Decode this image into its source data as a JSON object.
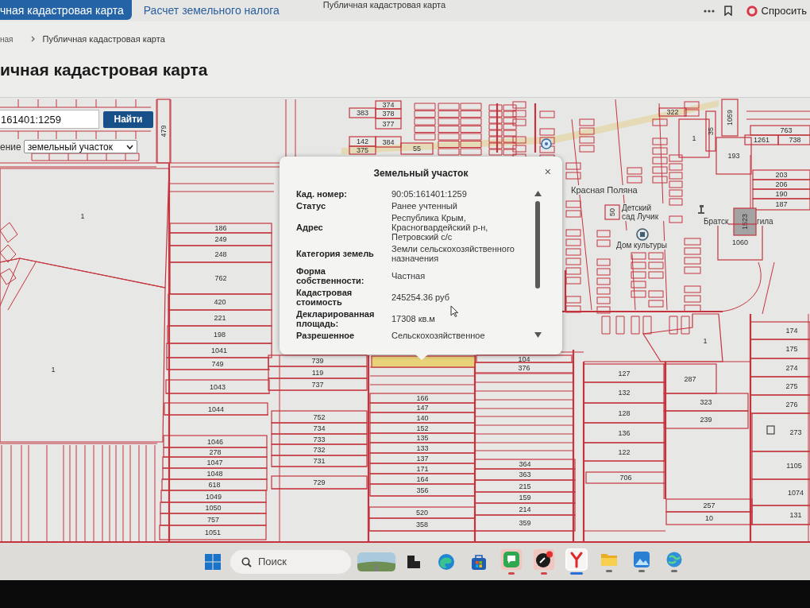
{
  "browser": {
    "page_title": "Публичная кадастровая карта",
    "ask_button": "Спросить"
  },
  "site_tabs": [
    {
      "label": "чная кадастровая карта",
      "selected": true
    },
    {
      "label": "Расчет земельного налога",
      "selected": false
    }
  ],
  "breadcrumbs": [
    {
      "label": "ная"
    },
    {
      "label": "Публичная кадастровая карта"
    }
  ],
  "heading": "ичная кадастровая карта",
  "map_search": {
    "value": "161401:1259",
    "button": "Найти",
    "layer_label": "ение",
    "layer_value": "земельный участок"
  },
  "map": {
    "parcels": [
      {
        "number": "479",
        "selected": false
      },
      {
        "number": "383",
        "selected": false
      },
      {
        "number": "374",
        "selected": false
      },
      {
        "number": "378",
        "selected": false
      },
      {
        "number": "377",
        "selected": false
      },
      {
        "number": "142",
        "selected": false
      },
      {
        "number": "384",
        "selected": false
      },
      {
        "number": "375",
        "selected": false
      },
      {
        "number": "55",
        "selected": false
      },
      {
        "number": "322",
        "selected": false
      },
      {
        "number": "1",
        "selected": false
      },
      {
        "number": "35",
        "selected": false
      },
      {
        "number": "1059",
        "selected": false
      },
      {
        "number": "763",
        "selected": false
      },
      {
        "number": "1261",
        "selected": false
      },
      {
        "number": "738",
        "selected": false
      },
      {
        "number": "193",
        "selected": false
      },
      {
        "number": "203",
        "selected": false
      },
      {
        "number": "206",
        "selected": false
      },
      {
        "number": "190",
        "selected": false
      },
      {
        "number": "187",
        "selected": false
      },
      {
        "number": "50",
        "selected": false
      },
      {
        "number": "1523",
        "selected": false
      },
      {
        "number": "1060",
        "selected": false
      },
      {
        "number": "186",
        "selected": false
      },
      {
        "number": "249",
        "selected": false
      },
      {
        "number": "248",
        "selected": false
      },
      {
        "number": "762",
        "selected": false
      },
      {
        "number": "420",
        "selected": false
      },
      {
        "number": "221",
        "selected": false
      },
      {
        "number": "198",
        "selected": false
      },
      {
        "number": "1041",
        "selected": false
      },
      {
        "number": "749",
        "selected": false
      },
      {
        "number": "1043",
        "selected": false
      },
      {
        "number": "1044",
        "selected": false
      },
      {
        "number": "1046",
        "selected": false
      },
      {
        "number": "278",
        "selected": false
      },
      {
        "number": "1047",
        "selected": false
      },
      {
        "number": "1048",
        "selected": false
      },
      {
        "number": "618",
        "selected": false
      },
      {
        "number": "1049",
        "selected": false
      },
      {
        "number": "1050",
        "selected": false
      },
      {
        "number": "757",
        "selected": false
      },
      {
        "number": "1051",
        "selected": false
      },
      {
        "number": "1",
        "selected": false
      },
      {
        "number": "1",
        "selected": false
      },
      {
        "number": "739",
        "selected": false
      },
      {
        "number": "119",
        "selected": false
      },
      {
        "number": "737",
        "selected": false
      },
      {
        "number": "752",
        "selected": false
      },
      {
        "number": "734",
        "selected": false
      },
      {
        "number": "733",
        "selected": false
      },
      {
        "number": "732",
        "selected": false
      },
      {
        "number": "731",
        "selected": false
      },
      {
        "number": "729",
        "selected": false
      },
      {
        "selected": true
      },
      {
        "number": "166",
        "selected": false
      },
      {
        "number": "147",
        "selected": false
      },
      {
        "number": "140",
        "selected": false
      },
      {
        "number": "152",
        "selected": false
      },
      {
        "number": "135",
        "selected": false
      },
      {
        "number": "133",
        "selected": false
      },
      {
        "number": "137",
        "selected": false
      },
      {
        "number": "171",
        "selected": false
      },
      {
        "number": "164",
        "selected": false
      },
      {
        "number": "356",
        "selected": false
      },
      {
        "number": "520",
        "selected": false
      },
      {
        "number": "358",
        "selected": false
      },
      {
        "number": "104",
        "selected": false
      },
      {
        "number": "376",
        "selected": false
      },
      {
        "number": "364",
        "selected": false
      },
      {
        "number": "363",
        "selected": false
      },
      {
        "number": "215",
        "selected": false
      },
      {
        "number": "159",
        "selected": false
      },
      {
        "number": "214",
        "selected": false
      },
      {
        "number": "359",
        "selected": false
      },
      {
        "number": "127",
        "selected": false
      },
      {
        "number": "132",
        "selected": false
      },
      {
        "number": "128",
        "selected": false
      },
      {
        "number": "136",
        "selected": false
      },
      {
        "number": "122",
        "selected": false
      },
      {
        "number": "706",
        "selected": false
      },
      {
        "number": "287",
        "selected": false
      },
      {
        "number": "323",
        "selected": false
      },
      {
        "number": "239",
        "selected": false
      },
      {
        "number": "257",
        "selected": false
      },
      {
        "number": "10",
        "selected": false
      },
      {
        "number": "1",
        "selected": false
      },
      {
        "number": "174",
        "selected": false
      },
      {
        "number": "175",
        "selected": false
      },
      {
        "number": "274",
        "selected": false
      },
      {
        "number": "275",
        "selected": false
      },
      {
        "number": "276",
        "selected": false
      },
      {
        "number": "273",
        "selected": false
      },
      {
        "number": "1105",
        "selected": false
      },
      {
        "number": "1074",
        "selected": false
      },
      {
        "number": "131",
        "selected": false
      }
    ],
    "places": [
      {
        "name": "Красная Поляна"
      },
      {
        "name": "Детский сад Лучик"
      },
      {
        "name": "Дом культуры"
      },
      {
        "name": "Братск"
      },
      {
        "name": "гила"
      }
    ]
  },
  "popup": {
    "title": "Земельный участок",
    "close": "×",
    "fields": [
      {
        "label": "Кад. номер:",
        "value": "90:05:161401:1259"
      },
      {
        "label": "Статус",
        "value": "Ранее учтенный"
      },
      {
        "label": "Адрес",
        "value": "Республика Крым, Красногвардейский р-н, Петровский с/с"
      },
      {
        "label": "Категория земель",
        "value": "Земли сельскохозяйственного назначения"
      },
      {
        "label": "Форма собственности:",
        "value": "Частная"
      },
      {
        "label": "Кадастровая стоимость",
        "value": "245254.36 руб"
      },
      {
        "label": "Декларированная площадь:",
        "value": "17308 кв.м"
      },
      {
        "label": "Разрешенное",
        "value": "Сельскохозяйственное"
      }
    ]
  },
  "taskbar": {
    "search_placeholder": "Поиск",
    "apps": [
      {
        "kind": "landscape",
        "running": false,
        "active": false,
        "attention": false
      },
      {
        "kind": "task-view",
        "running": false,
        "active": false,
        "attention": false
      },
      {
        "kind": "browser",
        "running": false,
        "active": false,
        "attention": false
      },
      {
        "kind": "store",
        "running": false,
        "active": false,
        "attention": false
      },
      {
        "kind": "chat",
        "running": true,
        "active": false,
        "attention": true
      },
      {
        "kind": "player",
        "running": true,
        "active": false,
        "attention": true
      },
      {
        "kind": "letter",
        "running": true,
        "active": true,
        "attention": false
      },
      {
        "kind": "folder",
        "running": true,
        "active": false,
        "attention": false
      },
      {
        "kind": "photos",
        "running": true,
        "active": false,
        "attention": false
      },
      {
        "kind": "globe",
        "running": true,
        "active": false,
        "attention": false
      }
    ]
  }
}
